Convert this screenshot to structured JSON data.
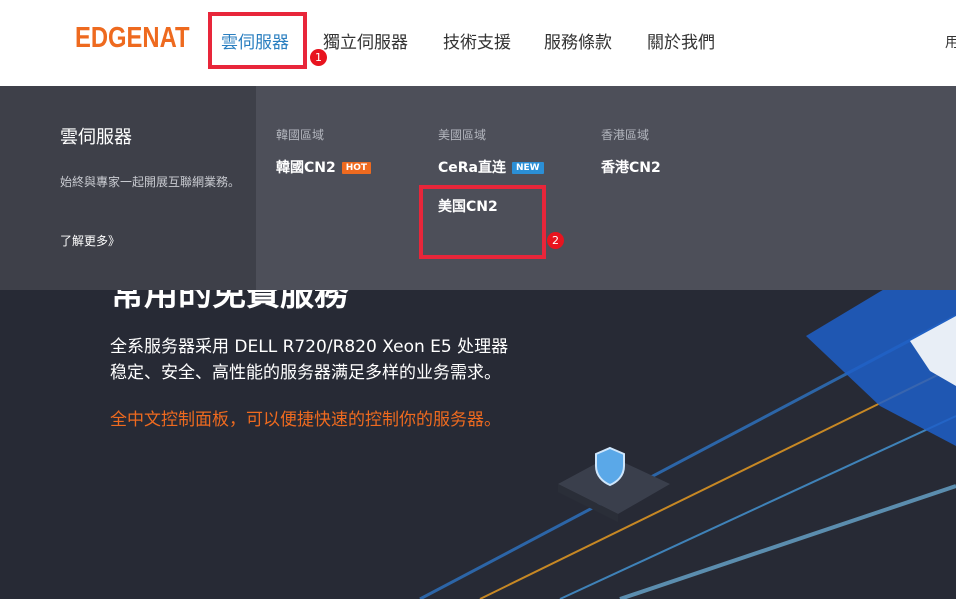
{
  "header": {
    "logo": "EDGENAT",
    "nav": [
      {
        "label": "雲伺服器"
      },
      {
        "label": "獨立伺服器"
      },
      {
        "label": "技術支援"
      },
      {
        "label": "服務條款"
      },
      {
        "label": "關於我們"
      }
    ],
    "user_fragment": "用"
  },
  "hero": {
    "title_fragment": "常用的免費服務",
    "line1": "全系服务器采用 DELL R720/R820 Xeon E5 处理器",
    "line2": "稳定、安全、高性能的服务器满足多样的业务需求。",
    "line3": "全中文控制面板，可以便捷快速的控制你的服务器。"
  },
  "dropdown": {
    "title": "雲伺服器",
    "description": "始終與專家一起開展互聯網業務。",
    "more_link": "了解更多》",
    "columns": [
      {
        "heading": "韓國區域",
        "items": [
          {
            "label": "韓國CN2",
            "badge": "HOT"
          }
        ]
      },
      {
        "heading": "美國區域",
        "items": [
          {
            "label": "CeRa直连",
            "badge": "NEW"
          },
          {
            "label": "美国CN2"
          }
        ]
      },
      {
        "heading": "香港區域",
        "items": [
          {
            "label": "香港CN2"
          }
        ]
      }
    ]
  },
  "annotations": [
    {
      "number": "1"
    },
    {
      "number": "2"
    }
  ],
  "colors": {
    "brand_orange": "#ee6a1f",
    "active_nav": "#2b7fc0",
    "hot_badge": "#ee6a1f",
    "new_badge": "#2b8fd6",
    "annotation_red": "#e8263a"
  }
}
